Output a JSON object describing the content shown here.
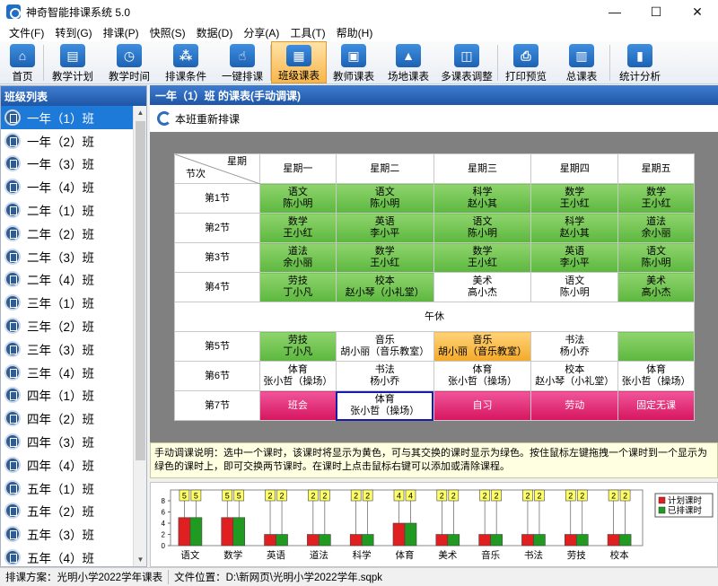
{
  "window": {
    "title": "神奇智能排课系统 5.0",
    "min": "—",
    "max": "☐",
    "close": "✕"
  },
  "menu": [
    "文件(F)",
    "转到(G)",
    "排课(P)",
    "快照(S)",
    "数据(D)",
    "分享(A)",
    "工具(T)",
    "帮助(H)"
  ],
  "toolbar": [
    {
      "label": "首页",
      "icon": "home-icon",
      "glyph": "⌂"
    },
    {
      "label": "教学计划",
      "icon": "book-icon",
      "glyph": "▤"
    },
    {
      "label": "教学时间",
      "icon": "clock-icon",
      "glyph": "◷"
    },
    {
      "label": "排课条件",
      "icon": "conditions-icon",
      "glyph": "⁂"
    },
    {
      "label": "一键排课",
      "icon": "hand-icon",
      "glyph": "☝"
    },
    {
      "label": "班级课表",
      "icon": "class-schedule-icon",
      "glyph": "▦",
      "active": true
    },
    {
      "label": "教师课表",
      "icon": "teacher-schedule-icon",
      "glyph": "▣"
    },
    {
      "label": "场地课表",
      "icon": "venue-schedule-icon",
      "glyph": "▲"
    },
    {
      "label": "多课表调整",
      "icon": "multi-schedule-icon",
      "glyph": "◫"
    },
    {
      "label": "打印预览",
      "icon": "printer-icon",
      "glyph": "⎙"
    },
    {
      "label": "总课表",
      "icon": "calendar-icon",
      "glyph": "▥"
    },
    {
      "label": "统计分析",
      "icon": "stats-icon",
      "glyph": "▮"
    }
  ],
  "left_panel": {
    "title": "班级列表",
    "classes": [
      "一年（1）班",
      "一年（2）班",
      "一年（3）班",
      "一年（4）班",
      "二年（1）班",
      "二年（2）班",
      "二年（3）班",
      "二年（4）班",
      "三年（1）班",
      "三年（2）班",
      "三年（3）班",
      "三年（4）班",
      "四年（1）班",
      "四年（2）班",
      "四年（3）班",
      "四年（4）班",
      "五年（1）班",
      "五年（2）班",
      "五年（3）班",
      "五年（4）班"
    ],
    "selected_index": 0
  },
  "main": {
    "title": "一年（1）班 的课表(手动调课)",
    "rearrange_label": "本班重新排课",
    "corner_top": "星期",
    "corner_bottom": "节次",
    "days": [
      "星期一",
      "星期二",
      "星期三",
      "星期四",
      "星期五"
    ],
    "noon_label": "午休",
    "periods": [
      {
        "label": "第1节",
        "cells": [
          {
            "subject": "语文",
            "teacher": "陈小明",
            "color": "green"
          },
          {
            "subject": "语文",
            "teacher": "陈小明",
            "color": "green"
          },
          {
            "subject": "科学",
            "teacher": "赵小其",
            "color": "green"
          },
          {
            "subject": "数学",
            "teacher": "王小红",
            "color": "green"
          },
          {
            "subject": "数学",
            "teacher": "王小红",
            "color": "green"
          }
        ]
      },
      {
        "label": "第2节",
        "cells": [
          {
            "subject": "数学",
            "teacher": "王小红",
            "color": "green"
          },
          {
            "subject": "英语",
            "teacher": "李小平",
            "color": "green"
          },
          {
            "subject": "语文",
            "teacher": "陈小明",
            "color": "green"
          },
          {
            "subject": "科学",
            "teacher": "赵小其",
            "color": "green"
          },
          {
            "subject": "道法",
            "teacher": "余小丽",
            "color": "green"
          }
        ]
      },
      {
        "label": "第3节",
        "cells": [
          {
            "subject": "道法",
            "teacher": "余小丽",
            "color": "green"
          },
          {
            "subject": "数学",
            "teacher": "王小红",
            "color": "green"
          },
          {
            "subject": "数学",
            "teacher": "王小红",
            "color": "green"
          },
          {
            "subject": "英语",
            "teacher": "李小平",
            "color": "green"
          },
          {
            "subject": "语文",
            "teacher": "陈小明",
            "color": "green"
          }
        ]
      },
      {
        "label": "第4节",
        "cells": [
          {
            "subject": "劳技",
            "teacher": "丁小凡",
            "color": "green"
          },
          {
            "subject": "校本",
            "teacher": "赵小琴（小礼堂）",
            "color": "green"
          },
          {
            "subject": "美术",
            "teacher": "高小杰",
            "color": "white"
          },
          {
            "subject": "语文",
            "teacher": "陈小明",
            "color": "white"
          },
          {
            "subject": "美术",
            "teacher": "高小杰",
            "color": "green"
          }
        ]
      }
    ],
    "periods_pm": [
      {
        "label": "第5节",
        "cells": [
          {
            "subject": "劳技",
            "teacher": "丁小凡",
            "color": "green"
          },
          {
            "subject": "音乐",
            "teacher": "胡小丽（音乐教室）",
            "color": "white"
          },
          {
            "subject": "音乐",
            "teacher": "胡小丽（音乐教室）",
            "color": "orange"
          },
          {
            "subject": "书法",
            "teacher": "杨小乔",
            "color": "white"
          },
          {
            "subject": "",
            "teacher": "",
            "color": "green"
          }
        ]
      },
      {
        "label": "第6节",
        "cells": [
          {
            "subject": "体育",
            "teacher": "张小哲（操场）",
            "color": "white"
          },
          {
            "subject": "书法",
            "teacher": "杨小乔",
            "color": "white"
          },
          {
            "subject": "体育",
            "teacher": "张小哲（操场）",
            "color": "white"
          },
          {
            "subject": "校本",
            "teacher": "赵小琴（小礼堂）",
            "color": "white"
          },
          {
            "subject": "体育",
            "teacher": "张小哲（操场）",
            "color": "white"
          }
        ]
      },
      {
        "label": "第7节",
        "cells": [
          {
            "subject": "班会",
            "teacher": "",
            "color": "pink"
          },
          {
            "subject": "体育",
            "teacher": "张小哲（操场）",
            "color": "selected"
          },
          {
            "subject": "自习",
            "teacher": "",
            "color": "pink"
          },
          {
            "subject": "劳动",
            "teacher": "",
            "color": "pink"
          },
          {
            "subject": "固定无课",
            "teacher": "",
            "color": "pink"
          }
        ]
      }
    ],
    "note": "手动调课说明：选中一个课时，该课时将显示为黄色，可与其交换的课时显示为绿色。按住鼠标左键拖拽一个课时到一个显示为绿色的课时上，即可交换两节课时。在课时上点击鼠标右键可以添加或清除课程。"
  },
  "colors": {
    "green": "#6cc24a",
    "orange": "#f7b940",
    "pink": "#e0226f",
    "planned": "#e02020",
    "scheduled": "#209a20",
    "header": "#2a64b8"
  },
  "chart_data": {
    "type": "bar",
    "categories": [
      "语文",
      "数学",
      "英语",
      "道法",
      "科学",
      "体育",
      "美术",
      "音乐",
      "书法",
      "劳技",
      "校本"
    ],
    "series": [
      {
        "name": "计划课时",
        "values": [
          5,
          5,
          2,
          2,
          2,
          4,
          2,
          2,
          2,
          2,
          2
        ]
      },
      {
        "name": "已排课时",
        "values": [
          5,
          5,
          2,
          2,
          2,
          4,
          2,
          2,
          2,
          2,
          2
        ]
      }
    ],
    "yticks": [
      "0",
      "2",
      "4",
      "6",
      "8"
    ],
    "ylim": [
      0,
      8
    ],
    "legend_position": "right"
  },
  "status": {
    "plan_label": "排课方案：光明小学2022学年课表",
    "file_label": "文件位置：D:\\新网页\\光明小学2022学年.sqpk"
  }
}
